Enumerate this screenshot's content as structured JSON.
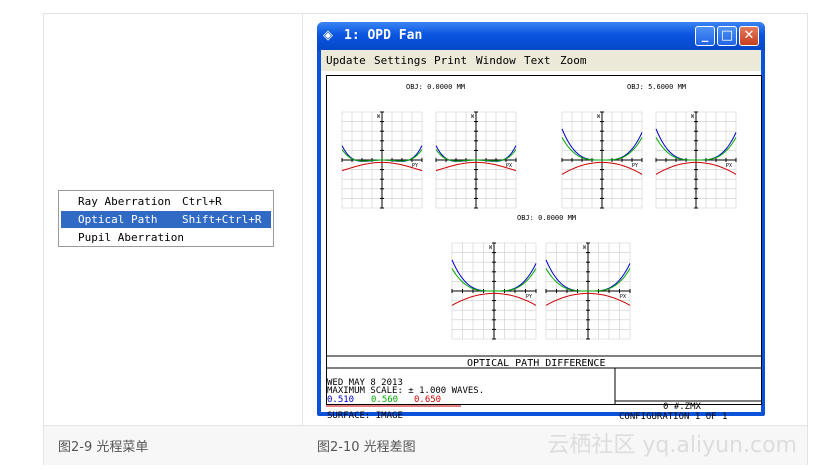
{
  "menu": {
    "items": [
      {
        "label": "Ray Aberration",
        "shortcut": "Ctrl+R",
        "selected": false
      },
      {
        "label": "Optical Path",
        "shortcut": "Shift+Ctrl+R",
        "selected": true
      },
      {
        "label": "Pupil Aberration",
        "shortcut": "",
        "selected": false
      }
    ]
  },
  "window": {
    "title": "1: OPD Fan",
    "app_icon": "zemax-icon",
    "buttons": [
      "minimize-icon",
      "maximize-icon",
      "close-icon"
    ],
    "menubar": [
      "Update",
      "Settings",
      "Print",
      "Window",
      "Text",
      "Zoom"
    ]
  },
  "plot": {
    "field_labels": [
      "OBJ: 0.0000 MM",
      "OBJ: 5.6000 MM",
      "OBJ: 0.0000 MM"
    ],
    "axis_w": "W",
    "axis_px": "PX",
    "axis_py": "PY",
    "footer_title": "OPTICAL PATH DIFFERENCE",
    "date": "WED MAY 8 2013",
    "max_scale": "MAXIMUM SCALE: ± 1.000 WAVES.",
    "wavelengths": [
      "0.510",
      "0.560",
      "0.650"
    ],
    "surface": "SURFACE: IMAGE",
    "file": "0    #.ZMX",
    "configuration": "CONFIGURATION  1 OF 1"
  },
  "colors": {
    "blue": "#0000cc",
    "green": "#00aa00",
    "red": "#cc0000",
    "selection": "#316ac5"
  },
  "captions": {
    "left": "图2-9 光程菜单",
    "right": "图2-10 光程差图"
  },
  "watermark": "云栖社区 yq.aliyun.com"
}
